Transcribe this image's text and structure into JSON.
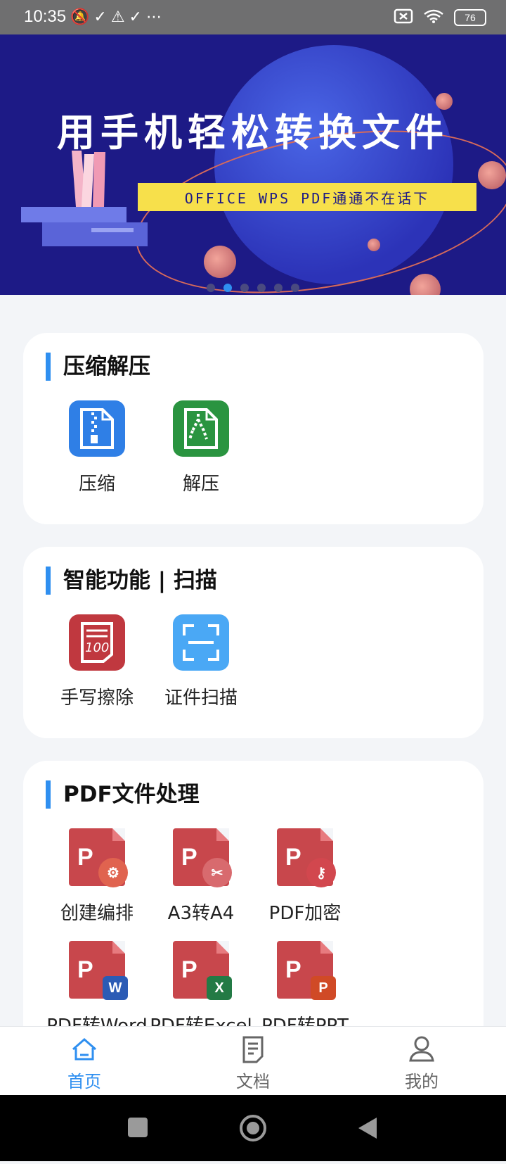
{
  "status_bar": {
    "time": "10:35",
    "left_icons": "🔕✓⚠✓⋯",
    "battery": "76"
  },
  "banner": {
    "title": "用手机轻松转换文件",
    "subtitle": "OFFICE WPS PDF通通不在话下",
    "indicator_count": 6,
    "active_index": 1
  },
  "sections": {
    "compress": {
      "title": "压缩解压",
      "items": [
        {
          "label": "压缩",
          "icon": "zip-icon",
          "color": "#2f7fe6"
        },
        {
          "label": "解压",
          "icon": "unzip-icon",
          "color": "#2a9440"
        }
      ]
    },
    "smart": {
      "title": "智能功能 | 扫描",
      "items": [
        {
          "label": "手写擦除",
          "icon": "handwriting-erase-icon",
          "color": "#c0383f"
        },
        {
          "label": "证件扫描",
          "icon": "scan-frame-icon",
          "color": "#4aa8f5"
        }
      ]
    },
    "pdf": {
      "title": "PDF文件处理",
      "items": [
        {
          "label": "创建编排",
          "icon": "pdf-gear-icon"
        },
        {
          "label": "A3转A4",
          "icon": "pdf-scissors-icon"
        },
        {
          "label": "PDF加密",
          "icon": "pdf-key-icon"
        },
        {
          "label": "PDF转Word",
          "icon": "pdf-word-icon"
        },
        {
          "label": "PDF转Excel",
          "icon": "pdf-excel-icon"
        },
        {
          "label": "PDF转PPT",
          "icon": "pdf-ppt-icon"
        }
      ]
    }
  },
  "bottom_nav": [
    {
      "label": "首页",
      "icon": "home-icon",
      "active": true
    },
    {
      "label": "文档",
      "icon": "document-icon",
      "active": false
    },
    {
      "label": "我的",
      "icon": "profile-icon",
      "active": false
    }
  ],
  "colors": {
    "accent": "#2f8ff0",
    "banner_bg": "#1d1a86",
    "banner_sub_bg": "#f7e04b",
    "page_bg": "#f3f5f8"
  }
}
